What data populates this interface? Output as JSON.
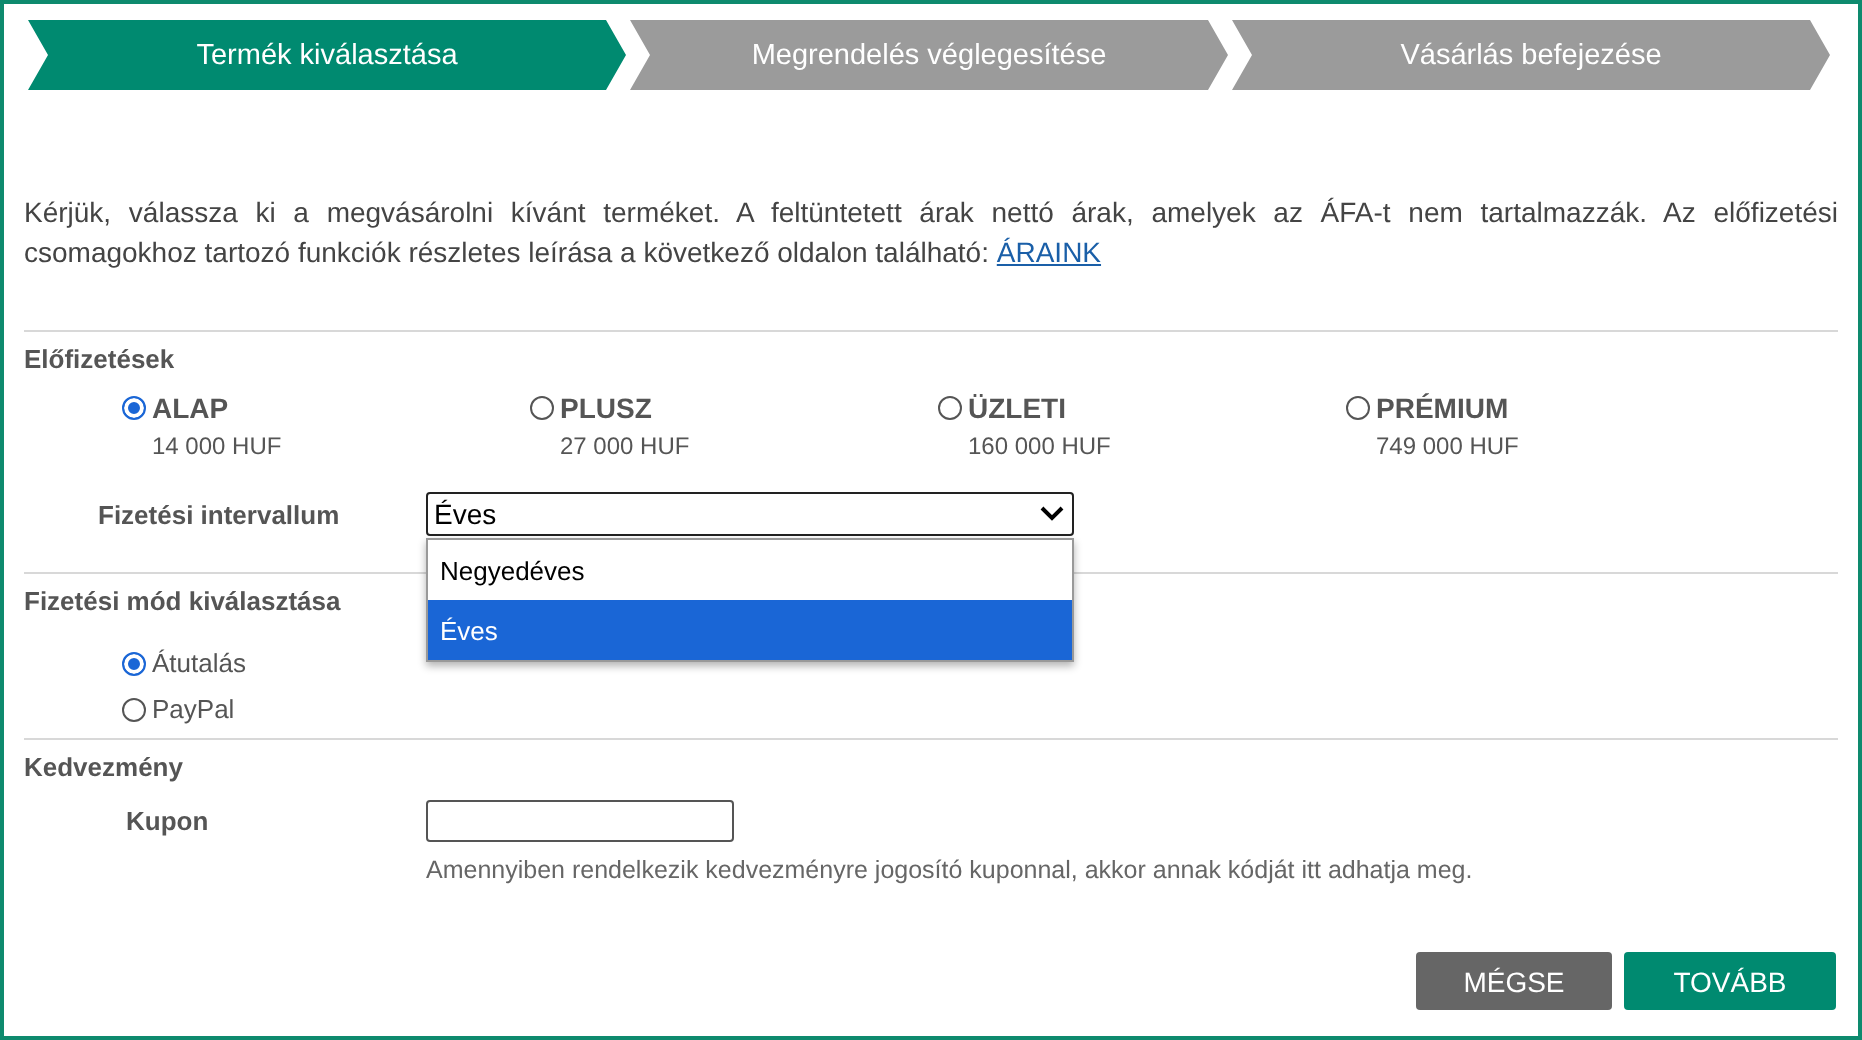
{
  "steps": [
    {
      "label": "Termék kiválasztása",
      "selected": true
    },
    {
      "label": "Megrendelés véglegesítése",
      "selected": false
    },
    {
      "label": "Vásárlás befejezése",
      "selected": false
    }
  ],
  "intro": {
    "text": "Kérjük, válassza ki a megvásárolni kívánt terméket. A feltüntetett árak nettó árak, amelyek az ÁFA-t nem tartalmazzák. Az előfizetési csomagokhoz tartozó funkciók részletes leírása a következő oldalon található:",
    "link": "ÁRAINK"
  },
  "subscriptions": {
    "heading": "Előfizetések",
    "plans": [
      {
        "name": "ALAP",
        "price": "14 000 HUF",
        "selected": true
      },
      {
        "name": "PLUSZ",
        "price": "27 000 HUF",
        "selected": false
      },
      {
        "name": "ÜZLETI",
        "price": "160 000 HUF",
        "selected": false
      },
      {
        "name": "PRÉMIUM",
        "price": "749 000 HUF",
        "selected": false
      }
    ],
    "interval": {
      "label": "Fizetési intervallum",
      "value": "Éves",
      "open": true,
      "options": [
        {
          "label": "Negyedéves",
          "selected": false
        },
        {
          "label": "Éves",
          "selected": true
        }
      ]
    }
  },
  "payment": {
    "heading": "Fizetési mód kiválasztása",
    "methods": [
      {
        "label": "Átutalás",
        "selected": true
      },
      {
        "label": "PayPal",
        "selected": false
      }
    ]
  },
  "discount": {
    "heading": "Kedvezmény",
    "coupon_label": "Kupon",
    "help": "Amennyiben rendelkezik kedvezményre jogosító kuponnal, akkor annak kódját itt adhatja meg."
  },
  "buttons": [
    {
      "label": "MÉGSE",
      "kind": "secondary"
    },
    {
      "label": "TOVÁBB",
      "kind": "primary"
    }
  ]
}
